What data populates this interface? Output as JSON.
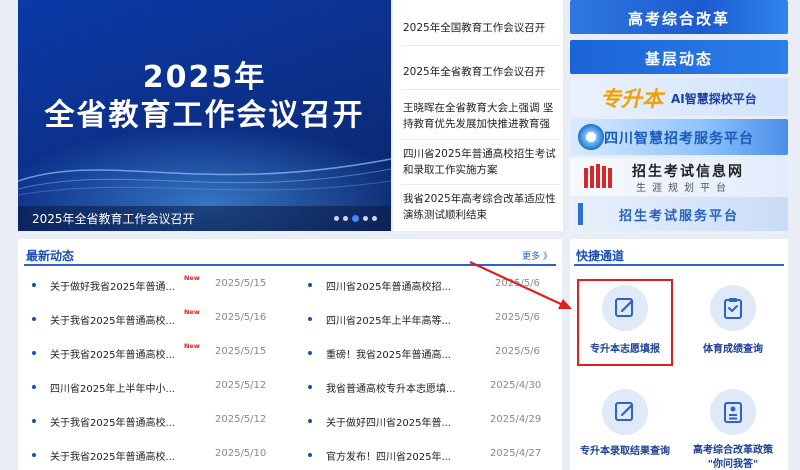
{
  "carousel": {
    "year": "2025年",
    "headline": "全省教育工作会议召开",
    "caption": "2025年全省教育工作会议召开"
  },
  "headlines": [
    {
      "text": "2025年全国教育工作会议召开"
    },
    {
      "text": "2025年全省教育工作会议召开"
    },
    {
      "text": "王晓晖在全省教育大会上强调 坚持教育优先发展加快推进教育强省..."
    },
    {
      "text": "四川省2025年普通高校招生考试和录取工作实施方案"
    },
    {
      "text": "我省2025年高考综合改革适应性演练测试顺利结束"
    }
  ],
  "banners": {
    "b1": "高考综合改革",
    "b2": "基层动态",
    "b3_big": "专升本",
    "b3_small": "AI智慧探校平台",
    "b4": "四川智慧招考服务平台",
    "b5_title": "招生考试信息网",
    "b5_sub": "生涯规划平台",
    "b6": "招生考试服务平台"
  },
  "news": {
    "title": "最新动态",
    "more": "更多 》",
    "new_label": "New",
    "left": [
      {
        "text": "关于做好我省2025年普通...",
        "date": "2025/5/15",
        "is_new": true
      },
      {
        "text": "关于我省2025年普通高校...",
        "date": "2025/5/16",
        "is_new": true
      },
      {
        "text": "关于我省2025年普通高校...",
        "date": "2025/5/15",
        "is_new": true
      },
      {
        "text": "四川省2025年上半年中小...",
        "date": "2025/5/12",
        "is_new": false
      },
      {
        "text": "关于我省2025年普通高校...",
        "date": "2025/5/12",
        "is_new": false
      },
      {
        "text": "关于我省2025年普通高校...",
        "date": "2025/5/10",
        "is_new": false
      }
    ],
    "right": [
      {
        "text": "四川省2025年普通高校招...",
        "date": "2025/5/6"
      },
      {
        "text": "四川省2025年上半年高等...",
        "date": "2025/5/6"
      },
      {
        "text": "重磅！我省2025年普通高...",
        "date": "2025/5/6"
      },
      {
        "text": "我省普通高校专升本志愿填...",
        "date": "2025/4/30"
      },
      {
        "text": "关于做好四川省2025年普...",
        "date": "2025/4/29"
      },
      {
        "text": "官方发布！四川省2025年...",
        "date": "2025/4/27"
      }
    ]
  },
  "quick": {
    "title": "快捷通道",
    "items": [
      {
        "label": "专升本志愿填报",
        "icon": "edit-icon"
      },
      {
        "label": "体育成绩查询",
        "icon": "clipboard-check-icon"
      },
      {
        "label": "专升本录取结果查询",
        "icon": "edit-icon"
      },
      {
        "label": "高考综合改革政策",
        "label2": "\"你问我答\"",
        "icon": "id-card-icon"
      }
    ]
  },
  "colors": {
    "accent": "#2b63c9",
    "highlight": "#e02020",
    "new_tag": "#e0201a"
  }
}
